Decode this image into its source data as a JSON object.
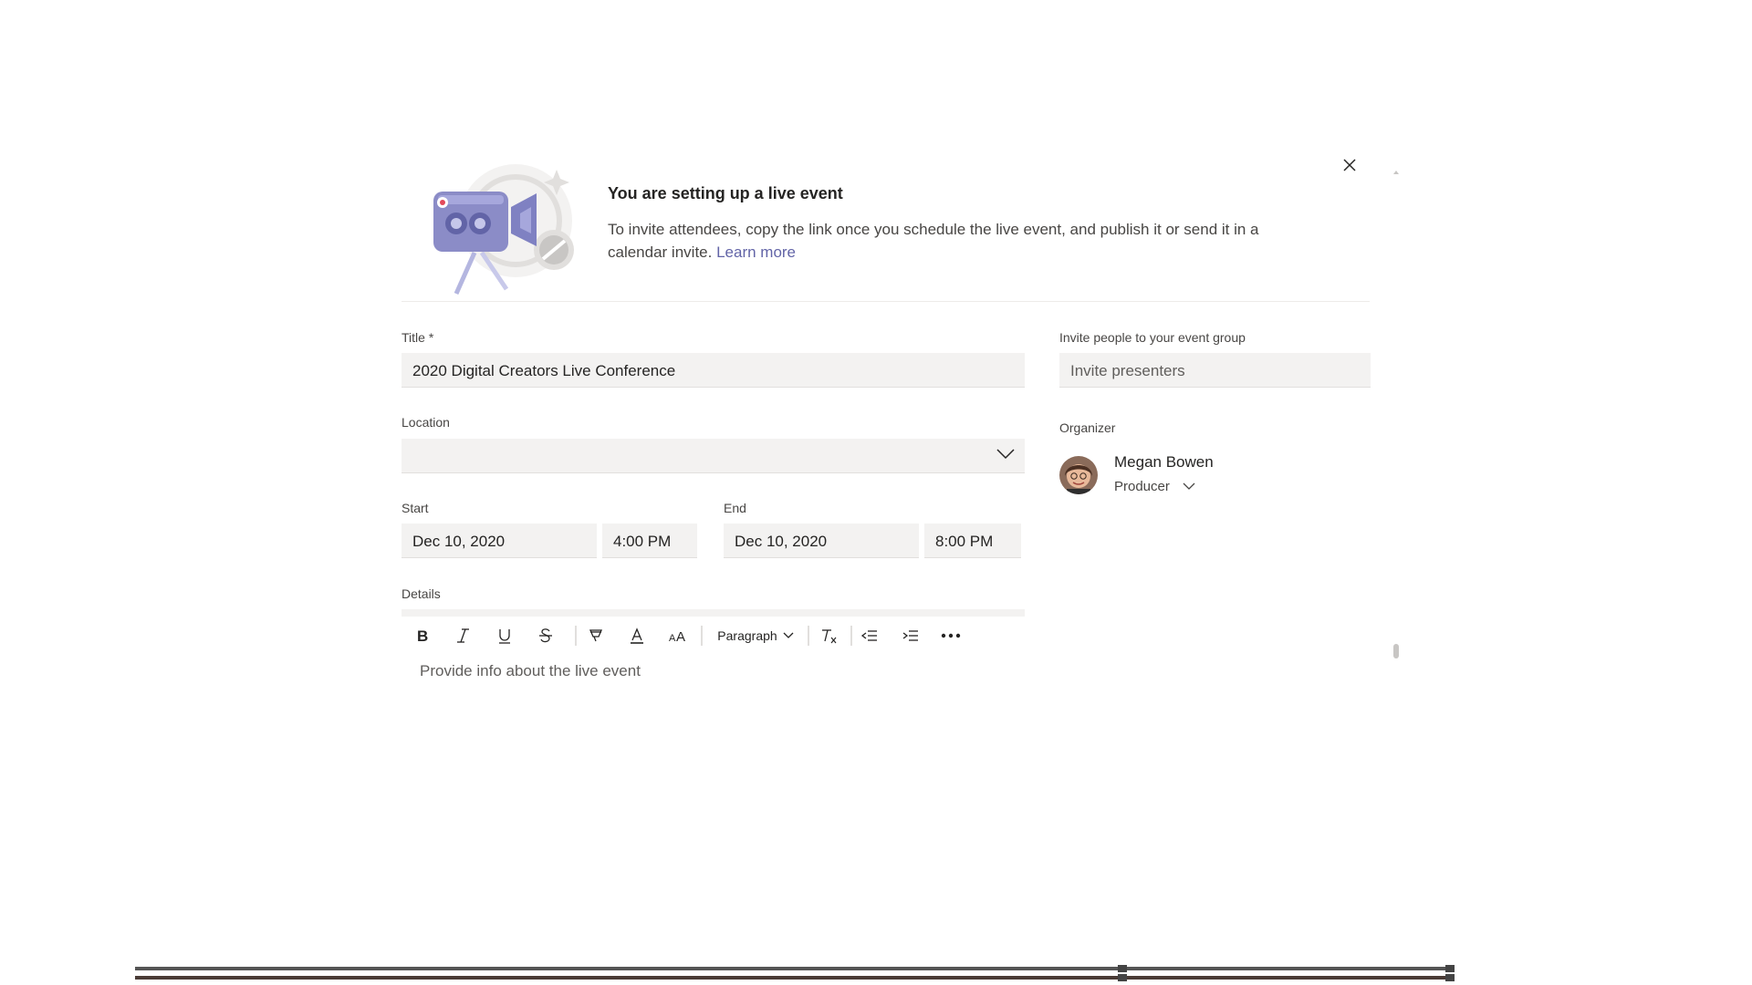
{
  "banner": {
    "title": "You are setting up a live event",
    "text": "To invite attendees, copy the link once you schedule the live event, and publish it or send it in a calendar invite.",
    "learn_more": "Learn more"
  },
  "form": {
    "title_label": "Title *",
    "title_value": "2020 Digital Creators Live Conference",
    "location_label": "Location",
    "location_value": "",
    "start_label": "Start",
    "start_date": "Dec 10, 2020",
    "start_time": "4:00 PM",
    "end_label": "End",
    "end_date": "Dec 10, 2020",
    "end_time": "8:00 PM",
    "details_label": "Details",
    "details_placeholder": "Provide info about the live event",
    "toolbar": {
      "paragraph_label": "Paragraph",
      "tools": [
        "bold-icon",
        "italic-icon",
        "underline-icon",
        "strikethrough-icon",
        "highlight-icon",
        "font-color-icon",
        "font-size-icon",
        "clear-formatting-icon",
        "decrease-indent-icon",
        "increase-indent-icon",
        "more-options-icon"
      ]
    }
  },
  "right": {
    "invite_label": "Invite people to your event group",
    "invite_placeholder": "Invite presenters",
    "organizer_label": "Organizer",
    "organizer_name": "Megan Bowen",
    "organizer_role": "Producer"
  },
  "colors": {
    "accent": "#6264a7",
    "field_bg": "#f3f2f1",
    "text": "#252423"
  }
}
